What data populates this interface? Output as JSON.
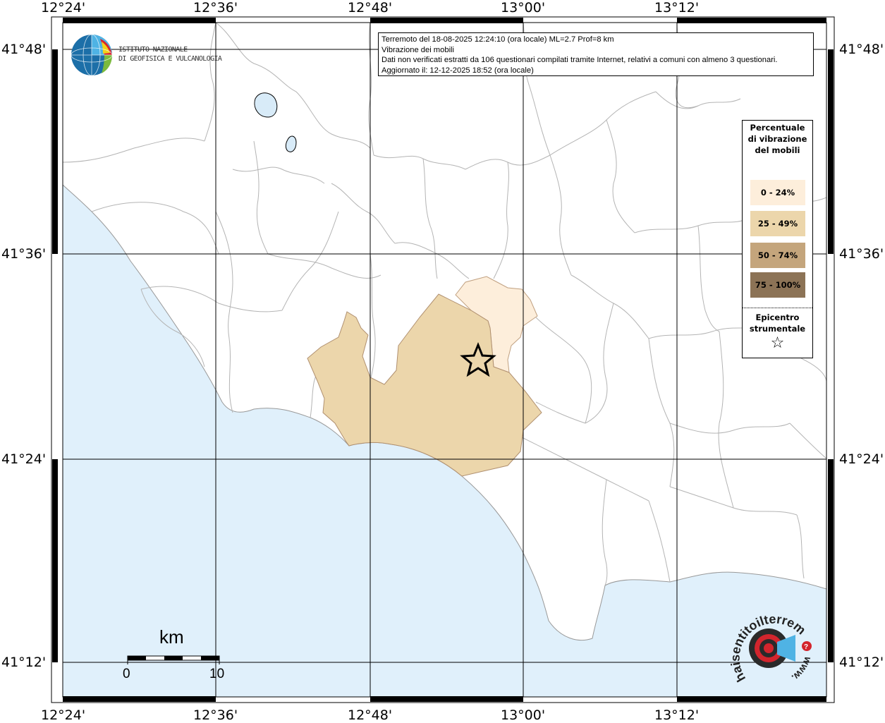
{
  "map": {
    "longitude_labels": [
      "12°24'",
      "12°36'",
      "12°48'",
      "13°00'",
      "13°12'"
    ],
    "latitude_labels": [
      "41°48'",
      "41°36'",
      "41°24'",
      "41°12'"
    ],
    "sea_color": "#e0f0fb",
    "land_color": "#ffffff",
    "border_color": "#b4b4b4"
  },
  "header": {
    "line1": "Terremoto del 18-08-2025 12:24:10 (ora locale) ML=2.7 Prof=8 km",
    "line2": "Vibrazione dei mobili",
    "line3": "Dati non verificati estratti da 106 questionari compilati tramite Internet, relativi a comuni con almeno 3 questionari.",
    "line4": "Aggiornato il: 12-12-2025 18:52 (ora locale)"
  },
  "ingv": {
    "line1": "ISTITUTO NAZIONALE",
    "line2": "DI GEOFISICA E VULCANOLOGIA"
  },
  "legend": {
    "title": "Percentuale di vibrazione del mobili",
    "items": [
      {
        "label": "0 - 24%",
        "color": "#fdeedb"
      },
      {
        "label": "25 - 49%",
        "color": "#ecd6ab"
      },
      {
        "label": "50 - 74%",
        "color": "#c4a57c"
      },
      {
        "label": "75 - 100%",
        "color": "#8c7356"
      }
    ],
    "epicenter_title": "Epicentro strumentale",
    "epicenter_symbol": "☆"
  },
  "scale_bar": {
    "unit": "km",
    "start": "0",
    "end": "10"
  },
  "hst_logo": {
    "text": "haisentitoilterremoto.it",
    "prefix": "www.",
    "question": "?"
  }
}
